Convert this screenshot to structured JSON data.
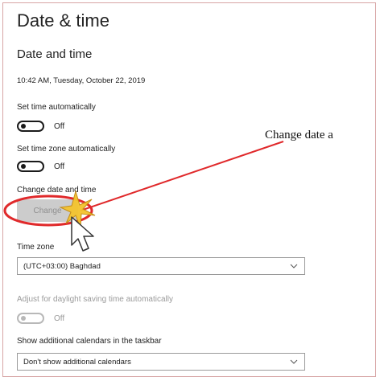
{
  "page": {
    "title": "Date & time",
    "section_title": "Date and time",
    "current_datetime": "10:42 AM, Tuesday, October 22, 2019"
  },
  "settings": {
    "set_time_auto": {
      "label": "Set time automatically",
      "state": "Off"
    },
    "set_timezone_auto": {
      "label": "Set time zone automatically",
      "state": "Off"
    },
    "change_date_time": {
      "label": "Change date and time",
      "button": "Change"
    },
    "time_zone": {
      "label": "Time zone",
      "value": "(UTC+03:00) Baghdad"
    },
    "daylight_saving": {
      "label": "Adjust for daylight saving time automatically",
      "state": "Off"
    },
    "additional_calendars": {
      "label": "Show additional calendars in the taskbar",
      "value": "Don't show additional calendars"
    }
  },
  "annotation": {
    "callout_text": "Change date a"
  },
  "icons": [
    "chevron-down-icon",
    "mouse-cursor-icon",
    "click-burst-icon"
  ],
  "colors": {
    "annotation_red": "#e0292b",
    "burst_yellow": "#f3c42e",
    "button_disabled_bg": "#cccccc",
    "button_disabled_text": "#8f8f8f"
  }
}
